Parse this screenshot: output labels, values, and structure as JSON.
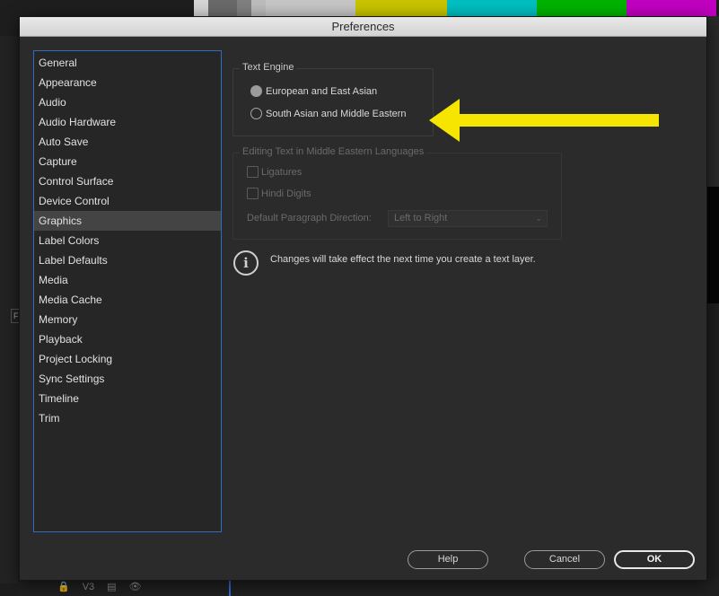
{
  "background": {
    "color_bars": [
      "#d5d5d5",
      "#6a6a6a",
      "#808080",
      "#bcbcbc",
      "#c6c6c6",
      "#c8c400",
      "#00bfc0",
      "#00b300",
      "#c000c0"
    ],
    "left_tab_label": "F",
    "bottom_track_label": "V3"
  },
  "dialog": {
    "title": "Preferences",
    "categories": [
      {
        "label": "General"
      },
      {
        "label": "Appearance"
      },
      {
        "label": "Audio"
      },
      {
        "label": "Audio Hardware"
      },
      {
        "label": "Auto Save"
      },
      {
        "label": "Capture"
      },
      {
        "label": "Control Surface"
      },
      {
        "label": "Device Control"
      },
      {
        "label": "Graphics",
        "selected": true
      },
      {
        "label": "Label Colors"
      },
      {
        "label": "Label Defaults"
      },
      {
        "label": "Media"
      },
      {
        "label": "Media Cache"
      },
      {
        "label": "Memory"
      },
      {
        "label": "Playback"
      },
      {
        "label": "Project Locking"
      },
      {
        "label": "Sync Settings"
      },
      {
        "label": "Timeline"
      },
      {
        "label": "Trim"
      }
    ],
    "text_engine": {
      "title": "Text Engine",
      "option1": "European and East Asian",
      "option2": "South Asian and Middle Eastern",
      "selected": "European and East Asian"
    },
    "editing": {
      "title": "Editing Text in Middle Eastern Languages",
      "ligatures": "Ligatures",
      "hindi_digits": "Hindi Digits",
      "direction_label": "Default Paragraph Direction:",
      "direction_value": "Left to Right"
    },
    "info": {
      "icon": "i",
      "text": "Changes will take effect the next time you create a text layer."
    },
    "buttons": {
      "help": "Help",
      "cancel": "Cancel",
      "ok": "OK"
    },
    "annotation_color": "#f5e500"
  }
}
